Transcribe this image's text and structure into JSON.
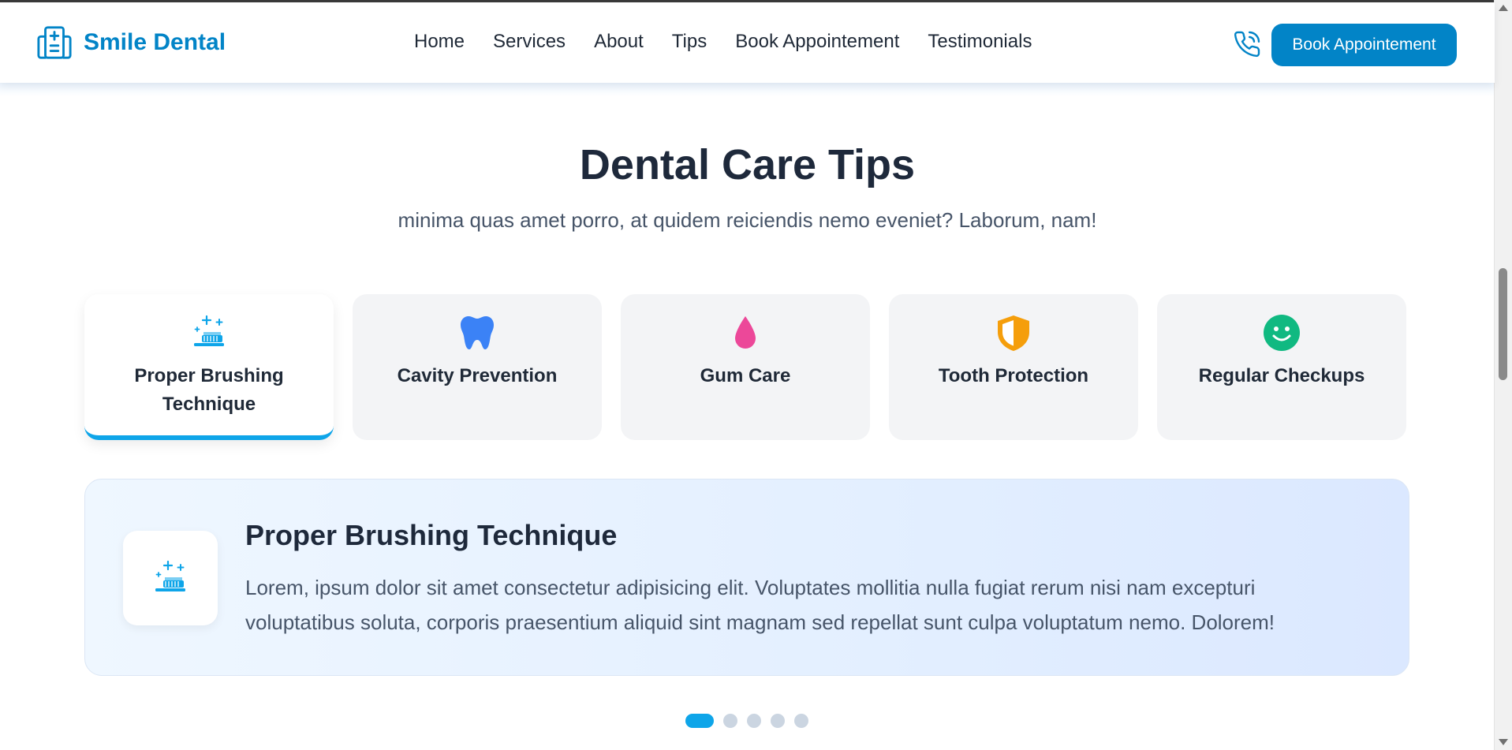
{
  "header": {
    "brand": "Smile Dental",
    "nav": [
      "Home",
      "Services",
      "About",
      "Tips",
      "Book Appointement",
      "Testimonials"
    ],
    "cta": "Book Appointement",
    "icons": {
      "logo": "hospital-icon",
      "phone": "phone-icon"
    }
  },
  "section": {
    "title": "Dental Care Tips",
    "subtitle": "minima quas amet porro, at quidem reiciendis nemo eveniet? Laborum, nam!"
  },
  "tabs": [
    {
      "label": "Proper Brushing Technique",
      "icon": "toothbrush-icon",
      "color": "#0ea5e9",
      "active": true
    },
    {
      "label": "Cavity Prevention",
      "icon": "tooth-icon",
      "color": "#3b82f6"
    },
    {
      "label": "Gum Care",
      "icon": "droplet-icon",
      "color": "#ec4899"
    },
    {
      "label": "Tooth Protection",
      "icon": "shield-icon",
      "color": "#f59e0b"
    },
    {
      "label": "Regular Checkups",
      "icon": "smile-icon",
      "color": "#10b981"
    }
  ],
  "detail": {
    "title": "Proper Brushing Technique",
    "text": "Lorem, ipsum dolor sit amet consectetur adipisicing elit. Voluptates mollitia nulla fugiat rerum nisi nam excepturi voluptatibus soluta, corporis praesentium aliquid sint magnam sed repellat sunt culpa voluptatum nemo. Dolorem!",
    "icon": "toothbrush-icon"
  },
  "pagination": {
    "count": 5,
    "active": 1
  },
  "colors": {
    "brand": "#0284c7",
    "accent": "#0ea5e9"
  }
}
